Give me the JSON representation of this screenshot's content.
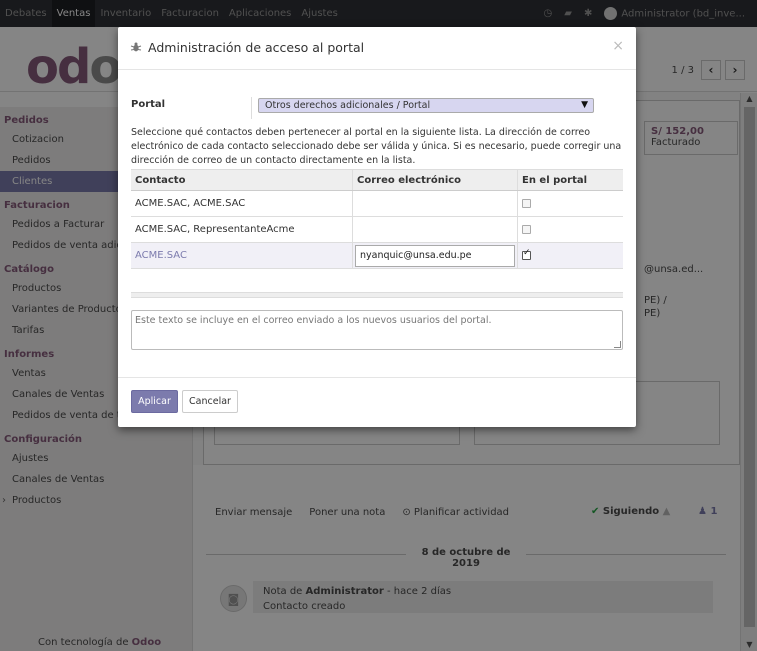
{
  "navbar": {
    "menu": [
      "Debates",
      "Ventas",
      "Inventario",
      "Facturacion",
      "Aplicaciones",
      "Ajustes"
    ],
    "active_index": 1,
    "user": "Administrator (bd_inve..."
  },
  "control_panel": {
    "logo_a": "od",
    "logo_b": "o",
    "pager": "1 / 3"
  },
  "sidebar": {
    "sections": [
      {
        "title": "Pedidos",
        "items": [
          "Cotizacion",
          "Pedidos",
          "Clientes"
        ]
      },
      {
        "title": "Facturacion",
        "items": [
          "Pedidos a Facturar",
          "Pedidos de venta adicio"
        ]
      },
      {
        "title": "Catálogo",
        "items": [
          "Productos",
          "Variantes de Producto",
          "Tarifas"
        ]
      },
      {
        "title": "Informes",
        "items": [
          "Ventas",
          "Canales de Ventas",
          "Pedidos de venta de to"
        ]
      },
      {
        "title": "Configuración",
        "items": [
          "Ajustes",
          "Canales de Ventas",
          "Productos"
        ]
      }
    ],
    "powered_prefix": "Con tecnología de",
    "powered_brand": "Odoo"
  },
  "form_bg": {
    "smart_value": "S/ 152,00",
    "smart_label": "Facturado",
    "email_partial": "@unsa.ed...",
    "pe_line1": "PE) /",
    "pe_line2": "PE)"
  },
  "chatter": {
    "send_message": "Enviar mensaje",
    "log_note": "Poner una nota",
    "schedule": "Planificar actividad",
    "following": "Siguiendo",
    "followers_count": "1",
    "date": "8 de octubre de 2019",
    "note_prefix": "Nota de",
    "note_author": "Administrator",
    "note_time": "- hace 2 días",
    "note_body": "Contacto creado"
  },
  "modal": {
    "title": "Administración de acceso al portal",
    "close": "×",
    "portal_label": "Portal",
    "portal_value": "Otros derechos adicionales / Portal",
    "description": "Seleccione qué contactos deben pertenecer al portal en la siguiente lista. La dirección de correo electrónico de cada contacto seleccionado debe ser válida y única. Si es necesario, puede corregir una dirección de correo de un contacto directamente en la lista.",
    "columns": [
      "Contacto",
      "Correo electrónico",
      "En el portal"
    ],
    "rows": [
      {
        "contact": "ACME.SAC, ACME.SAC",
        "email": "",
        "in_portal": false
      },
      {
        "contact": "ACME.SAC, RepresentanteAcme",
        "email": "",
        "in_portal": false
      },
      {
        "contact": "ACME.SAC",
        "email": "nyanquic@unsa.edu.pe",
        "in_portal": true
      }
    ],
    "welcome_placeholder": "Este texto se incluye en el correo enviado a los nuevos usuarios del portal.",
    "apply_label": "Aplicar",
    "cancel_label": "Cancelar"
  },
  "colors": {
    "primary": "#7c7bad",
    "brand": "#875a7b",
    "navbar": "#2f3136"
  }
}
